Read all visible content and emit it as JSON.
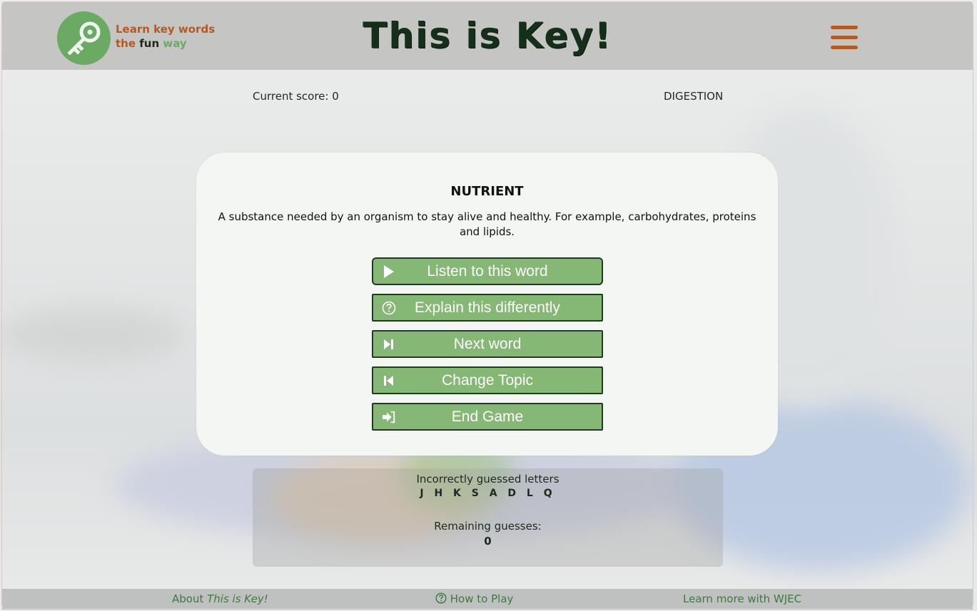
{
  "header": {
    "logo_line1": "Learn key words",
    "logo_the": "the",
    "logo_fun": "fun",
    "logo_way": "way",
    "title": "This is Key!",
    "menu_icon": "hamburger-menu-icon"
  },
  "status": {
    "score_label": "Current score: 0",
    "topic": "DIGESTION"
  },
  "card": {
    "word": "NUTRIENT",
    "definition": "A substance needed by an organism to stay alive and healthy. For example, carbohydrates, proteins and lipids.",
    "buttons": [
      {
        "label": "Listen to this word",
        "icon": "play-icon"
      },
      {
        "label": "Explain this differently",
        "icon": "question-circle-icon"
      },
      {
        "label": "Next word",
        "icon": "skip-forward-icon"
      },
      {
        "label": "Change Topic",
        "icon": "skip-back-icon"
      },
      {
        "label": "End Game",
        "icon": "sign-in-arrow-icon"
      }
    ]
  },
  "guesses": {
    "incorrect_label": "Incorrectly guessed letters",
    "incorrect_letters": "J H K S A D L Q",
    "remaining_label": "Remaining guesses:",
    "remaining_value": "0"
  },
  "footer": {
    "about_prefix": "About ",
    "about_title": "This is Key!",
    "how_to_play": "How to Play",
    "learn_more": "Learn more with WJEC"
  },
  "colors": {
    "accent_green": "#85b874",
    "logo_green": "#6aaa62",
    "accent_orange": "#b35a22",
    "title_dark": "#14301a"
  }
}
